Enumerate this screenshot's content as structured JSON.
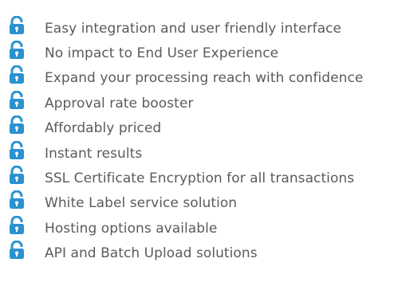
{
  "features": {
    "icon": "padlock-icon",
    "icon_color": "#2a92d0",
    "text_color": "#5b5b5b",
    "items": [
      {
        "label": "Easy integration and user friendly interface"
      },
      {
        "label": "No impact to End User Experience"
      },
      {
        "label": "Expand your processing reach with confidence"
      },
      {
        "label": "Approval rate booster"
      },
      {
        "label": "Affordably priced"
      },
      {
        "label": "Instant results"
      },
      {
        "label": "SSL Certificate Encryption for all transactions"
      },
      {
        "label": "White Label service solution"
      },
      {
        "label": "Hosting options available"
      },
      {
        "label": "API and Batch Upload solutions"
      }
    ]
  }
}
